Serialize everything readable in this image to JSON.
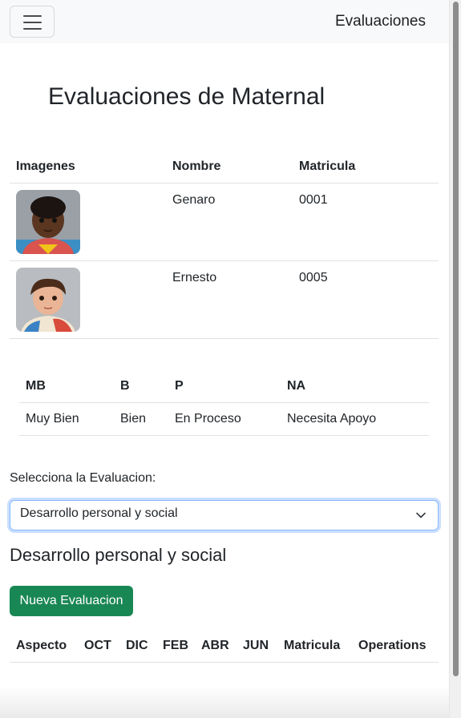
{
  "navbar": {
    "brand": "Evaluaciones",
    "menu_icon": "hamburger-menu-icon"
  },
  "page_title": "Evaluaciones de Maternal",
  "students_table": {
    "headers": [
      "Imagenes",
      "Nombre",
      "Matricula"
    ],
    "rows": [
      {
        "image": "child-portrait-genaro",
        "nombre": "Genaro",
        "matricula": "0001"
      },
      {
        "image": "child-portrait-ernesto",
        "nombre": "Ernesto",
        "matricula": "0005"
      }
    ]
  },
  "legend_table": {
    "headers": [
      "MB",
      "B",
      "P",
      "NA"
    ],
    "values": [
      "Muy Bien",
      "Bien",
      "En Proceso",
      "Necesita Apoyo"
    ]
  },
  "evaluation_select": {
    "label": "Selecciona la Evaluacion:",
    "selected": "Desarrollo personal y social",
    "icon": "chevron-down-icon"
  },
  "section_title": "Desarrollo personal y social",
  "new_button": "Nueva Evaluacion",
  "evaluations_table": {
    "headers": [
      "Aspecto",
      "OCT",
      "DIC",
      "FEB",
      "ABR",
      "JUN",
      "Matricula",
      "Operations"
    ]
  },
  "colors": {
    "navbar_bg": "#f8f9fa",
    "primary_button": "#198754",
    "focus_border": "#86b7fe",
    "text": "#212529"
  }
}
